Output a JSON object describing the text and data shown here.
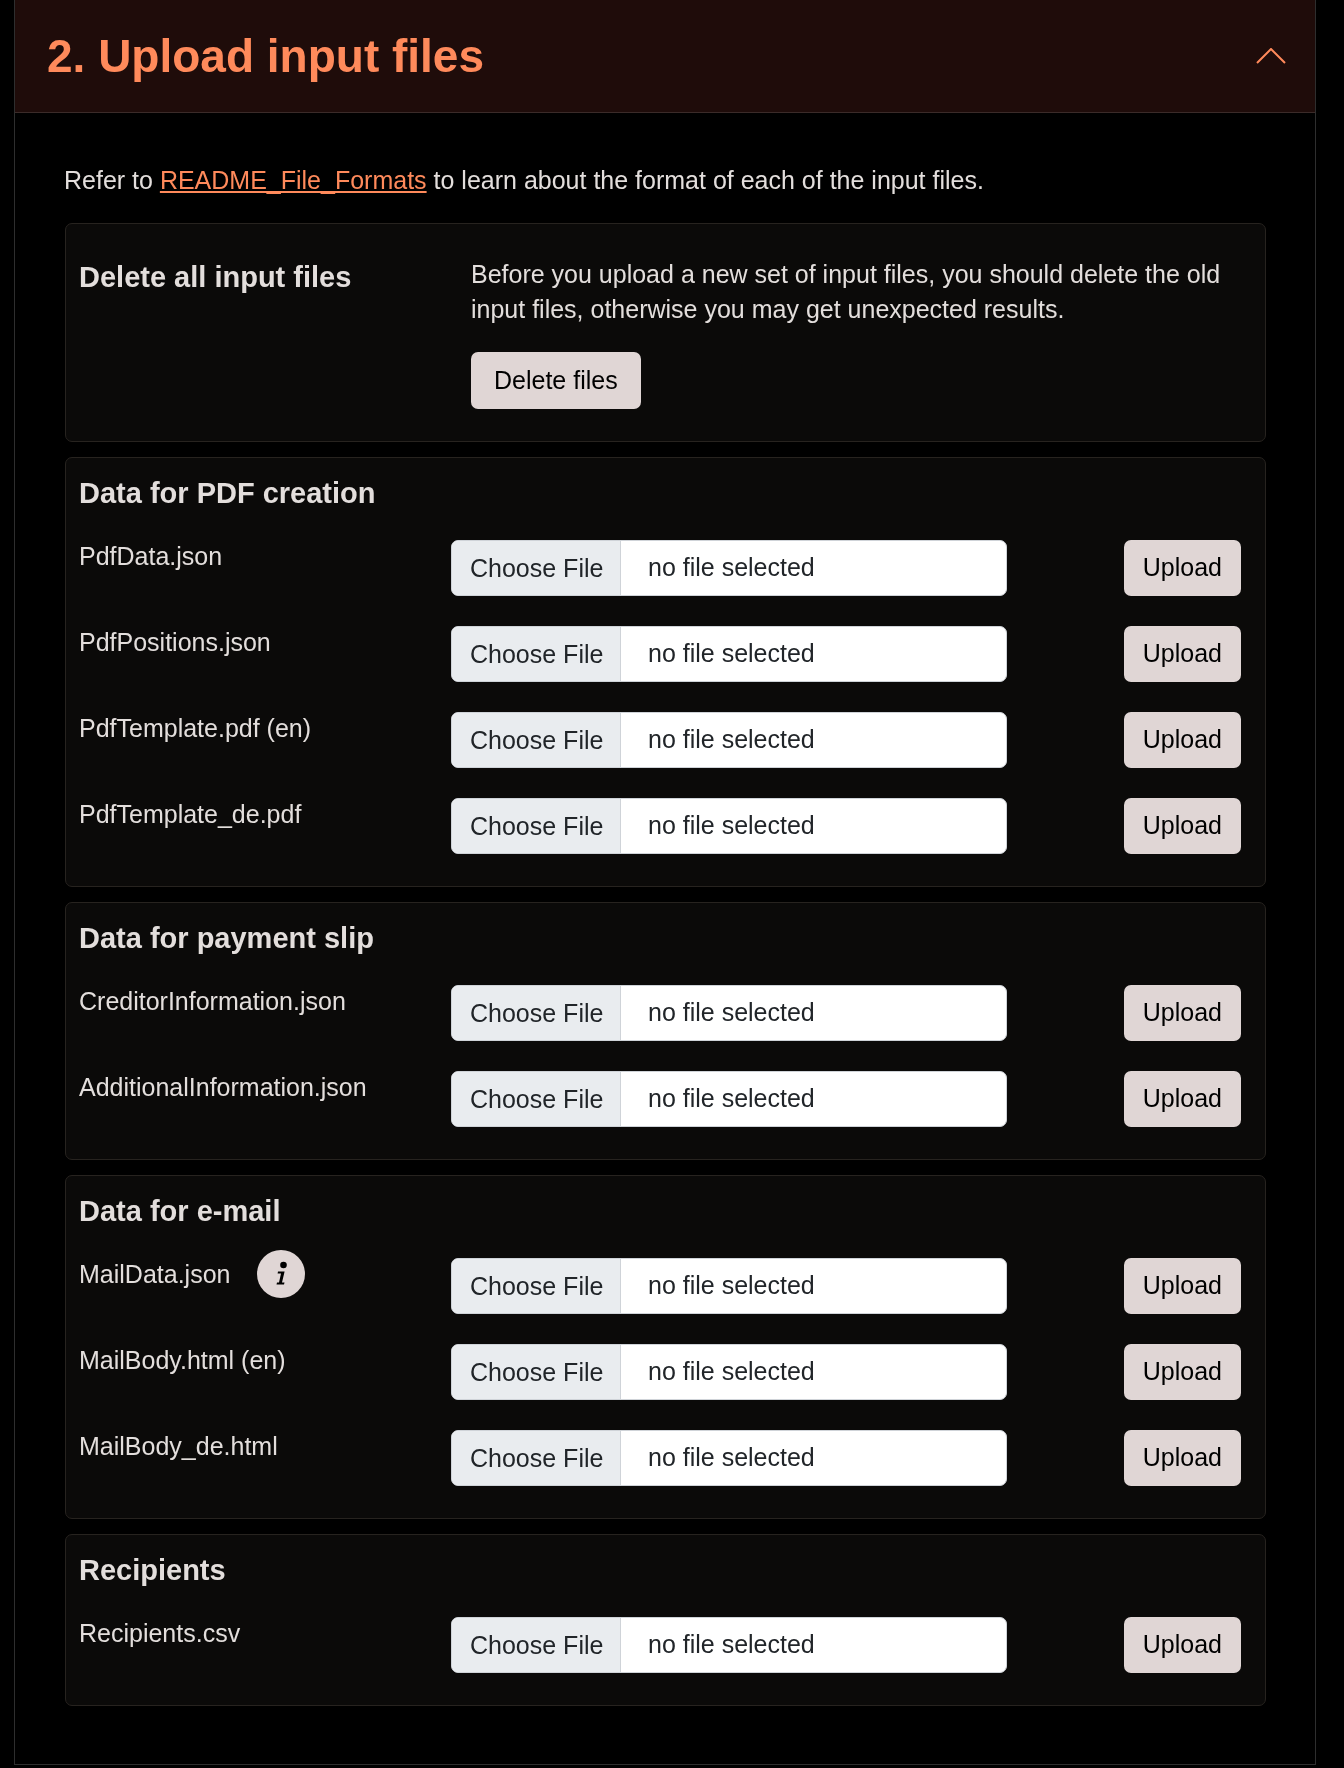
{
  "section": {
    "title": "2. Upload input files",
    "expanded": true
  },
  "intro": {
    "before": "Refer to ",
    "link": "README_File_Formats",
    "after": " to learn about the format of each of the input files."
  },
  "delete_card": {
    "title": "Delete all input files",
    "description": "Before you upload a new set of input files, you should delete the old input files, otherwise you may get unexpected results.",
    "button": "Delete files"
  },
  "groups": [
    {
      "title": "Data for PDF creation",
      "files": [
        {
          "label": "PdfData.json",
          "choose_button": "Choose File",
          "status": "no file selected",
          "upload_button": "Upload"
        },
        {
          "label": "PdfPositions.json",
          "choose_button": "Choose File",
          "status": "no file selected",
          "upload_button": "Upload"
        },
        {
          "label": "PdfTemplate.pdf (en)",
          "choose_button": "Choose File",
          "status": "no file selected",
          "upload_button": "Upload"
        },
        {
          "label": "PdfTemplate_de.pdf",
          "choose_button": "Choose File",
          "status": "no file selected",
          "upload_button": "Upload"
        }
      ]
    },
    {
      "title": "Data for payment slip",
      "files": [
        {
          "label": "CreditorInformation.json",
          "choose_button": "Choose File",
          "status": "no file selected",
          "upload_button": "Upload"
        },
        {
          "label": "AdditionalInformation.json",
          "choose_button": "Choose File",
          "status": "no file selected",
          "upload_button": "Upload"
        }
      ]
    },
    {
      "title": "Data for e-mail",
      "files": [
        {
          "label": "MailData.json",
          "info": true,
          "choose_button": "Choose File",
          "status": "no file selected",
          "upload_button": "Upload"
        },
        {
          "label": "MailBody.html (en)",
          "choose_button": "Choose File",
          "status": "no file selected",
          "upload_button": "Upload"
        },
        {
          "label": "MailBody_de.html",
          "choose_button": "Choose File",
          "status": "no file selected",
          "upload_button": "Upload"
        }
      ]
    },
    {
      "title": "Recipients",
      "files": [
        {
          "label": "Recipients.csv",
          "choose_button": "Choose File",
          "status": "no file selected",
          "upload_button": "Upload"
        }
      ]
    }
  ]
}
